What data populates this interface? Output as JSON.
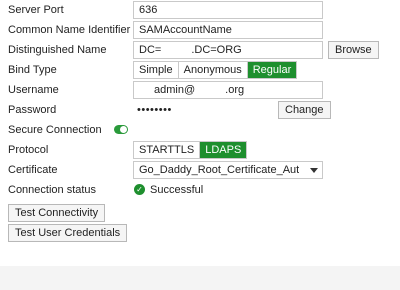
{
  "fields": {
    "server_port": {
      "label": "Server Port",
      "value": "636"
    },
    "common_name": {
      "label": "Common Name Identifier",
      "value": "SAMAccountName"
    },
    "dn": {
      "label": "Distinguished Name",
      "value_start": "DC=",
      "value_end": ".DC=ORG",
      "browse": "Browse"
    },
    "bind_type": {
      "label": "Bind Type",
      "options": [
        "Simple",
        "Anonymous",
        "Regular"
      ],
      "selected": "Regular"
    },
    "username": {
      "label": "Username",
      "value_start": "admin@",
      "value_end": ".org"
    },
    "password": {
      "label": "Password",
      "value": "••••••••",
      "change": "Change"
    },
    "secure_connection": {
      "label": "Secure Connection",
      "enabled": true
    },
    "protocol": {
      "label": "Protocol",
      "options": [
        "STARTTLS",
        "LDAPS"
      ],
      "selected": "LDAPS"
    },
    "certificate": {
      "label": "Certificate",
      "value": "Go_Daddy_Root_Certificate_Authority"
    },
    "connection_status": {
      "label": "Connection status",
      "value": "Successful"
    }
  },
  "buttons": {
    "test_connectivity": "Test Connectivity",
    "test_user_credentials": "Test User Credentials"
  },
  "colors": {
    "accent": "#1e8f2e",
    "toggle": "#2a9a3b"
  }
}
